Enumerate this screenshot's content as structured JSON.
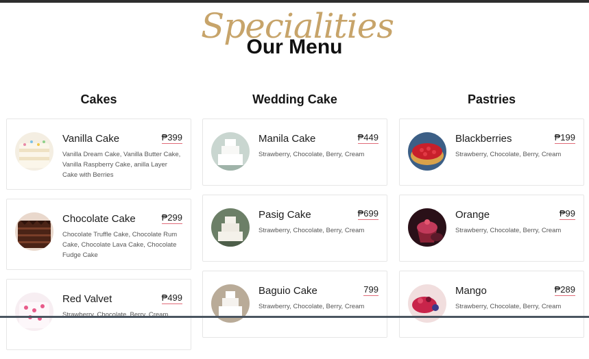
{
  "header": {
    "script_title": "Specialities",
    "title": "Our Menu"
  },
  "columns": [
    {
      "heading": "Cakes",
      "items": [
        {
          "name": "Vanilla Cake",
          "price": "₱399",
          "desc": "Vanilla Dream Cake, Vanilla Butter Cake, Vanilla Raspberry Cake, anilla Layer Cake with Berries",
          "icon": "vanilla-cake-photo"
        },
        {
          "name": "Chocolate Cake",
          "price": "₱299",
          "desc": "Chocolate Truffle Cake, Chocolate Rum Cake, Chocolate Lava Cake, Chocolate Fudge Cake",
          "icon": "chocolate-cake-photo"
        },
        {
          "name": "Red Valvet",
          "price": "₱499",
          "desc": "Strawberry, Chocolate, Berry, Cream",
          "icon": "red-velvet-photo"
        }
      ]
    },
    {
      "heading": "Wedding Cake",
      "items": [
        {
          "name": "Manila Cake",
          "price": "₱449",
          "desc": "Strawberry, Chocolate, Berry, Cream",
          "icon": "wedding-cake-photo"
        },
        {
          "name": "Pasig Cake",
          "price": "₱699",
          "desc": "Strawberry, Chocolate, Berry, Cream",
          "icon": "wedding-cake-photo"
        },
        {
          "name": "Baguio Cake",
          "price": "799",
          "desc": "Strawberry, Chocolate, Berry, Cream",
          "icon": "wedding-cake-photo"
        }
      ]
    },
    {
      "heading": "Pastries",
      "items": [
        {
          "name": "Blackberries",
          "price": "₱199",
          "desc": "Strawberry, Chocolate, Berry, Cream",
          "icon": "berry-tart-photo"
        },
        {
          "name": "Orange",
          "price": "₱99",
          "desc": "Strawberry, Chocolate, Berry, Cream",
          "icon": "cupcake-photo"
        },
        {
          "name": "Mango",
          "price": "₱289",
          "desc": "Strawberry, Chocolate, Berry, Cream",
          "icon": "cupcake-photo"
        }
      ]
    }
  ],
  "colors": {
    "script_gold": "#c7a46a",
    "price_underline": "#e06a78"
  }
}
